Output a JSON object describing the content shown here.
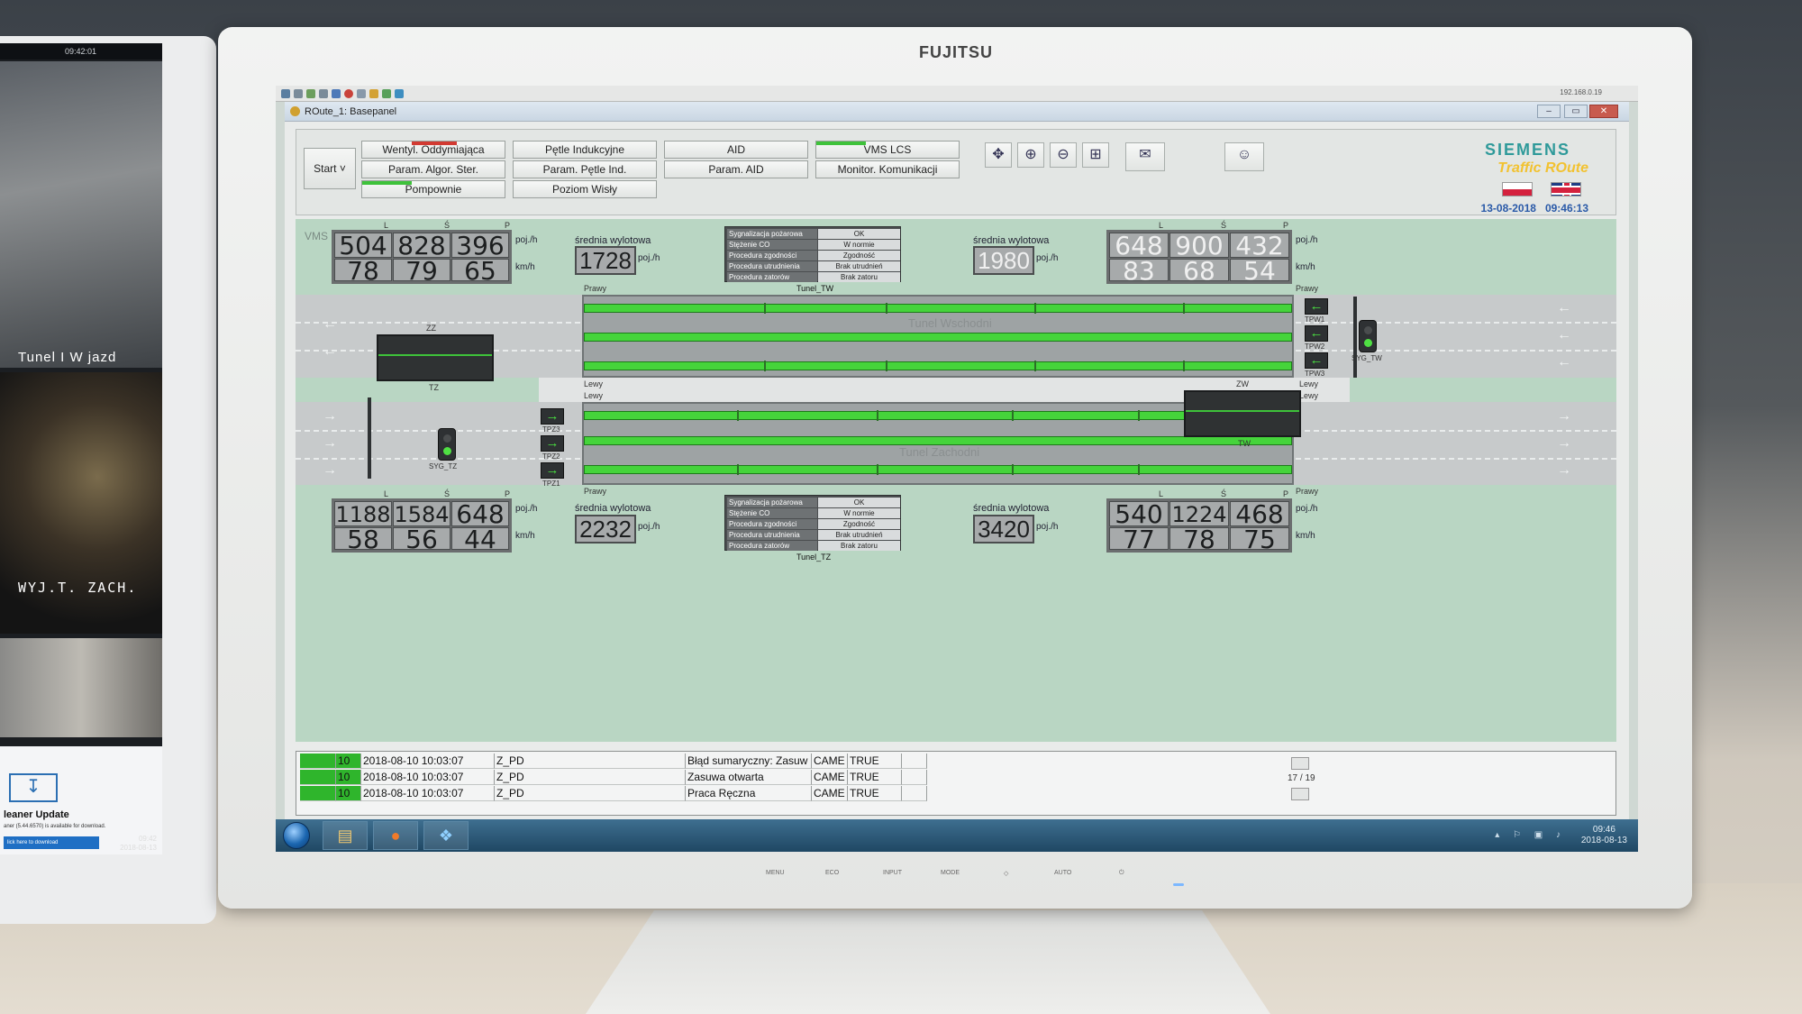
{
  "environment": {
    "brand": "FUJITSU",
    "bezel_buttons": [
      "MENU",
      "ECO",
      "INPUT",
      "MODE",
      "◇",
      "AUTO",
      "⏻"
    ]
  },
  "left_screen": {
    "top_clock": "09:42:01",
    "cam1_caption": "Tunel I W jazd",
    "cam2_caption": "WYJ.T. ZACH.",
    "toast_title": "leaner Update",
    "toast_line": "aner (5.44.6570) is available for download.",
    "toast_button": "lick here to download",
    "clock_time": "09:42",
    "clock_date": "2018-08-13",
    "lang": "PL"
  },
  "quick_bar": {
    "ip": "192.168.0.19"
  },
  "window": {
    "title": "ROute_1: Basepanel",
    "controls": [
      "–",
      "▭",
      "✕"
    ]
  },
  "toolbar": {
    "start_label": "Start ˅",
    "buttons": [
      {
        "label": "Wentyl. Oddymiająca",
        "indicator": "#d23a32"
      },
      {
        "label": "Param. Algor. Ster.",
        "indicator": ""
      },
      {
        "label": "Pompownie",
        "indicator": "#3ec23a"
      },
      {
        "label": "Pętle Indukcyjne",
        "indicator": ""
      },
      {
        "label": "Param. Pętle Ind.",
        "indicator": ""
      },
      {
        "label": "Poziom Wisły",
        "indicator": ""
      },
      {
        "label": "AID",
        "indicator": ""
      },
      {
        "label": "Param. AID",
        "indicator": ""
      },
      {
        "label": "VMS LCS",
        "indicator": "#3ec23a"
      },
      {
        "label": "Monitor. Komunikacji",
        "indicator": ""
      }
    ],
    "icons": [
      "move-icon",
      "zoom-in-icon",
      "zoom-out-icon",
      "zoom-fit-icon",
      "report-icon",
      "user-key-icon"
    ],
    "icon_glyphs": [
      "✥",
      "⊕",
      "⊖",
      "⊞",
      "✉",
      "☺"
    ],
    "logo": "SIEMENS",
    "product": "Traffic ROute",
    "date": "13-08-2018",
    "time": "09:46:13"
  },
  "panel": {
    "vms_label": "VMS",
    "col_headers": [
      "L",
      "Ś",
      "P"
    ],
    "units": {
      "flow": "poj./h",
      "speed": "km/h"
    },
    "avg_label": "średnia wylotowa",
    "top_left": {
      "flow": [
        "504",
        "828",
        "396"
      ],
      "speed": [
        "78",
        "79",
        "65"
      ]
    },
    "top_right": {
      "flow": [
        "648",
        "900",
        "432"
      ],
      "speed": [
        "83",
        "68",
        "54"
      ]
    },
    "bottom_left": {
      "flow": [
        "1188",
        "1584",
        "648"
      ],
      "speed": [
        "58",
        "56",
        "44"
      ]
    },
    "bottom_right": {
      "flow": [
        "540",
        "1224",
        "468"
      ],
      "speed": [
        "77",
        "78",
        "75"
      ]
    },
    "avg_top_left": "1728",
    "avg_top_right": "1980",
    "avg_bottom_left": "2232",
    "avg_bottom_right": "3420",
    "status_rows": [
      {
        "k": "Sygnalizacja pożarowa",
        "v": "OK"
      },
      {
        "k": "Stężenie CO",
        "v": "W normie"
      },
      {
        "k": "Procedura zgodności",
        "v": "Zgodność"
      },
      {
        "k": "Procedura utrudnienia",
        "v": "Brak utrudnień"
      },
      {
        "k": "Procedura zatorów",
        "v": "Brak zatoru"
      }
    ],
    "tunnel_top_id": "Tunel_TW",
    "tunnel_bottom_id": "Tunel_TZ",
    "tunnel_east": "Tunel Wschodni",
    "tunnel_west": "Tunel Zachodni",
    "lane_right": "Prawy",
    "lane_left": "Lewy",
    "tp_top": [
      "TPW1",
      "TPW2",
      "TPW3"
    ],
    "tp_bottom": [
      "TPZ3",
      "TPZ2",
      "TPZ1"
    ],
    "syg_tw": "SYG_TW",
    "syg_tz": "SYG_TZ",
    "vms_zz": "ZZ",
    "vms_tz": "TZ",
    "vms_zw": "ZW",
    "vms_tw": "TW"
  },
  "log": {
    "rows": [
      {
        "n": "10",
        "date": "2018-08-10 10:03:07",
        "src": "Z_PD",
        "msg": "Błąd sumaryczny: Zasuw",
        "who": "CAME",
        "state": "TRUE"
      },
      {
        "n": "10",
        "date": "2018-08-10 10:03:07",
        "src": "Z_PD",
        "msg": "Zasuwa otwarta",
        "who": "CAME",
        "state": "TRUE"
      },
      {
        "n": "10",
        "date": "2018-08-10 10:03:07",
        "src": "Z_PD",
        "msg": "Praca Ręczna",
        "who": "CAME",
        "state": "TRUE"
      }
    ],
    "pager": "17 / 19"
  },
  "taskbar": {
    "clock_time": "09:46",
    "clock_date": "2018-08-13",
    "apps": [
      "explorer-icon",
      "firefox-icon",
      "network-app-icon"
    ],
    "app_glyphs": [
      "▤",
      "●",
      "❖"
    ],
    "tray": "▴ ⚐ ▣ ♪"
  }
}
